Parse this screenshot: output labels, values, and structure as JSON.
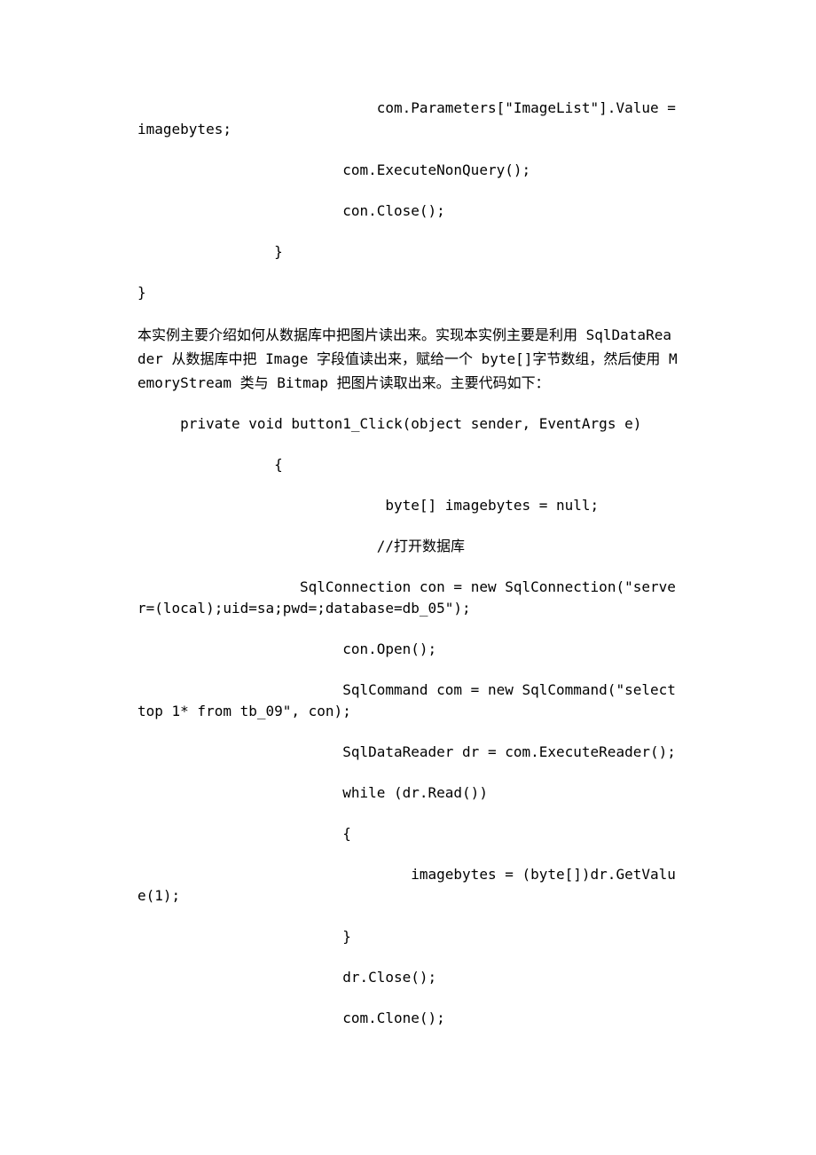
{
  "lines": [
    {
      "text": "                            com.Parameters[\"ImageList\"].Value = imagebytes;",
      "cls": "block"
    },
    {
      "text": "                        com.ExecuteNonQuery();",
      "cls": "block"
    },
    {
      "text": "                        con.Close();",
      "cls": "block"
    },
    {
      "text": "                }",
      "cls": "block"
    },
    {
      "text": "}",
      "cls": "block"
    },
    {
      "text": "本实例主要介绍如何从数据库中把图片读出来。实现本实例主要是利用 SqlDataReader 从数据库中把 Image 字段值读出来，赋给一个 byte[]字节数组，然后使用 MemoryStream 类与 Bitmap 把图片读取出来。主要代码如下：",
      "cls": "para"
    },
    {
      "text": "     private void button1_Click(object sender, EventArgs e)",
      "cls": "block"
    },
    {
      "text": "                {",
      "cls": "block"
    },
    {
      "text": "                             byte[] imagebytes = null;",
      "cls": "block"
    },
    {
      "text": "                            //打开数据库",
      "cls": "block"
    },
    {
      "text": "                   SqlConnection con = new SqlConnection(\"server=(local);uid=sa;pwd=;database=db_05\");",
      "cls": "block"
    },
    {
      "text": "                        con.Open();",
      "cls": "block"
    },
    {
      "text": "                        SqlCommand com = new SqlCommand(\"select top 1* from tb_09\", con);",
      "cls": "block"
    },
    {
      "text": "                        SqlDataReader dr = com.ExecuteReader();",
      "cls": "block"
    },
    {
      "text": "                        while (dr.Read())",
      "cls": "block"
    },
    {
      "text": "                        {",
      "cls": "block"
    },
    {
      "text": "                                imagebytes = (byte[])dr.GetValue(1);",
      "cls": "block"
    },
    {
      "text": "                        }",
      "cls": "block"
    },
    {
      "text": "                        dr.Close();",
      "cls": "block"
    },
    {
      "text": "                        com.Clone();",
      "cls": "block"
    }
  ]
}
